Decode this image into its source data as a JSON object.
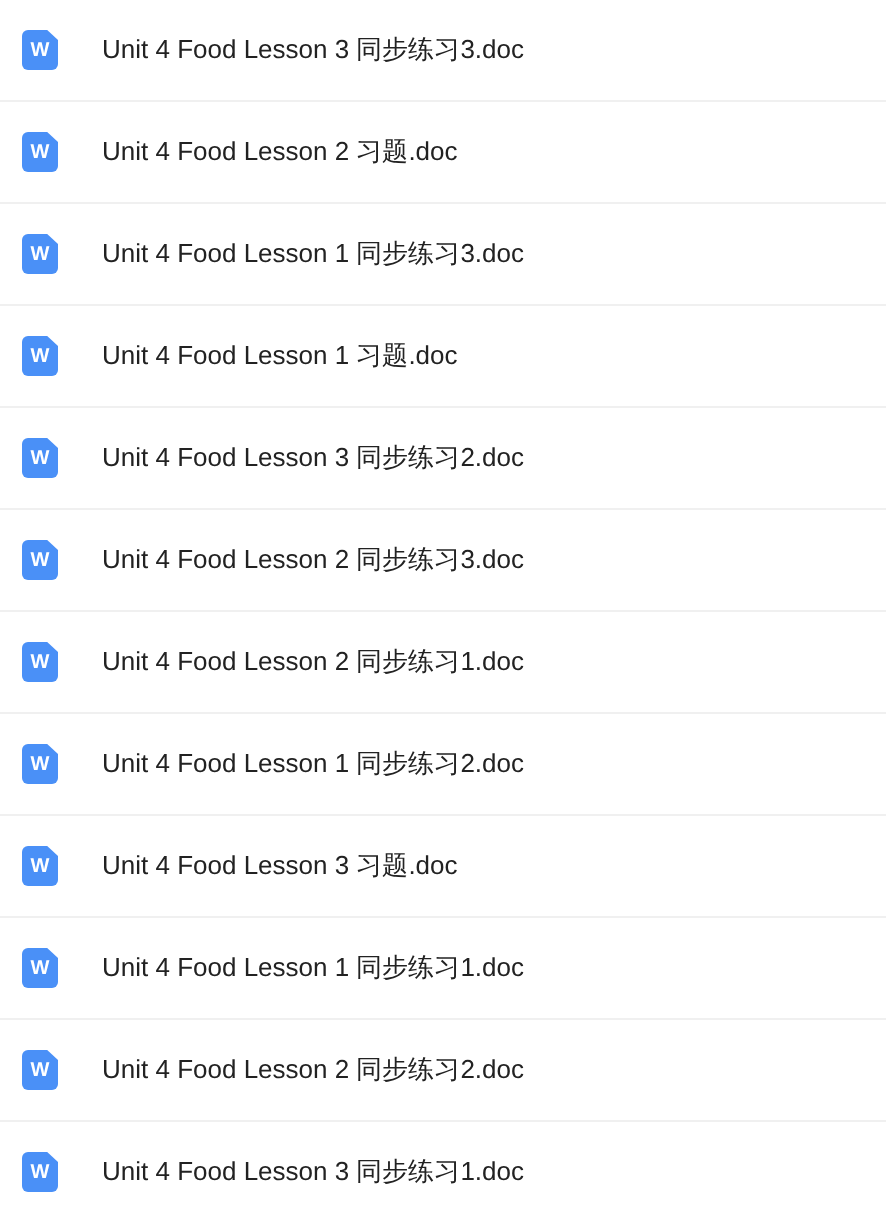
{
  "files": [
    {
      "icon_letter": "W",
      "name": "Unit 4 Food Lesson 3 同步练习3.doc"
    },
    {
      "icon_letter": "W",
      "name": "Unit 4 Food Lesson 2 习题.doc"
    },
    {
      "icon_letter": "W",
      "name": "Unit 4 Food Lesson 1 同步练习3.doc"
    },
    {
      "icon_letter": "W",
      "name": "Unit 4 Food Lesson 1 习题.doc"
    },
    {
      "icon_letter": "W",
      "name": "Unit 4 Food Lesson 3 同步练习2.doc"
    },
    {
      "icon_letter": "W",
      "name": "Unit 4 Food Lesson 2 同步练习3.doc"
    },
    {
      "icon_letter": "W",
      "name": "Unit 4 Food Lesson 2 同步练习1.doc"
    },
    {
      "icon_letter": "W",
      "name": "Unit 4 Food Lesson 1 同步练习2.doc"
    },
    {
      "icon_letter": "W",
      "name": "Unit 4 Food Lesson 3 习题.doc"
    },
    {
      "icon_letter": "W",
      "name": "Unit 4 Food Lesson 1 同步练习1.doc"
    },
    {
      "icon_letter": "W",
      "name": "Unit 4 Food Lesson 2 同步练习2.doc"
    },
    {
      "icon_letter": "W",
      "name": "Unit 4 Food Lesson 3 同步练习1.doc"
    }
  ]
}
